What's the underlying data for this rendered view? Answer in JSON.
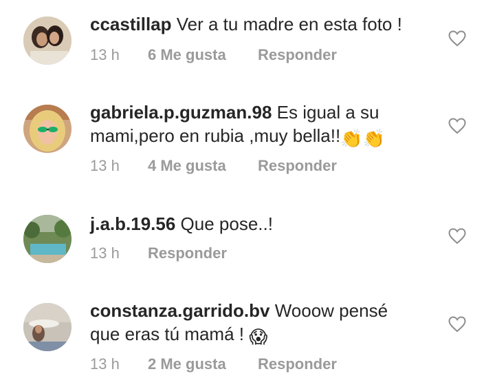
{
  "comments": [
    {
      "username": "ccastillap",
      "text": "Ver a tu madre en esta foto !",
      "time": "13 h",
      "likes": "6 Me gusta",
      "reply": "Responder"
    },
    {
      "username": "gabriela.p.guzman.98",
      "text": "Es igual a su mami,pero en rubia ,muy bella!!",
      "emoji": "👏👏",
      "time": "13 h",
      "likes": "4 Me gusta",
      "reply": "Responder"
    },
    {
      "username": "j.a.b.19.56",
      "text": "Que pose..!",
      "time": "13 h",
      "likes": "",
      "reply": "Responder"
    },
    {
      "username": "constanza.garrido.bv",
      "text": "Wooow pensé que eras tú mamá !",
      "emoji": "😱",
      "time": "13 h",
      "likes": "2 Me gusta",
      "reply": "Responder"
    }
  ],
  "icons": {
    "like": "heart-outline-icon"
  },
  "colors": {
    "text": "#262626",
    "meta": "#9a9a9a",
    "heart": "#8e8e8e"
  }
}
